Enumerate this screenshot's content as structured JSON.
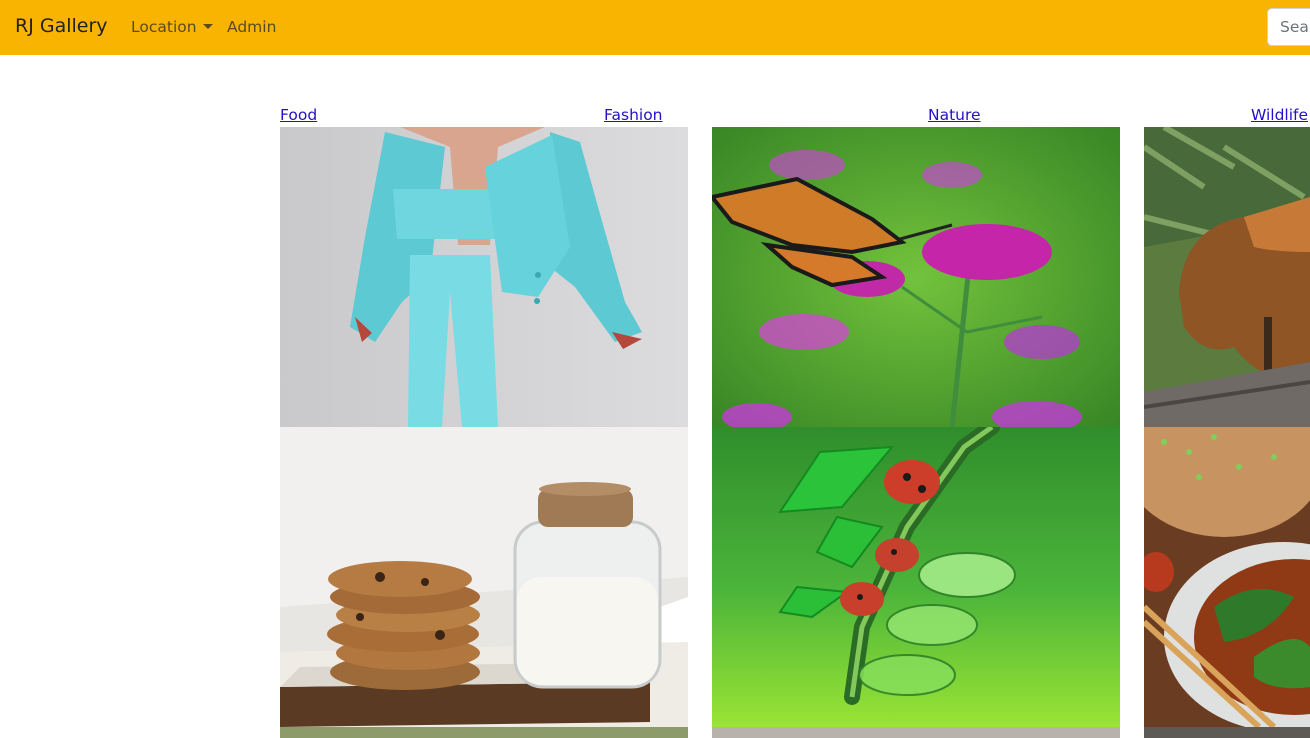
{
  "navbar": {
    "brand": "RJ Gallery",
    "location_label": "Location",
    "admin_label": "Admin",
    "search_placeholder": "Search"
  },
  "categories": [
    "Food",
    "Fashion",
    "Nature",
    "Wildlife"
  ],
  "gallery": [
    "fashion-suit-image",
    "butterfly-image",
    "fox-image",
    "cookies-milk-image",
    "ladybugs-image",
    "noodle-soup-image"
  ]
}
